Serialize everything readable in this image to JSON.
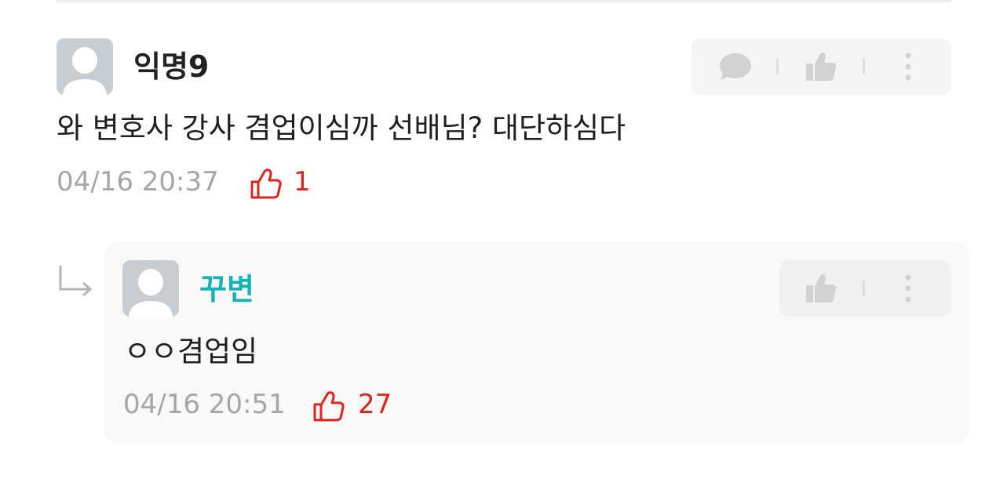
{
  "comment": {
    "author": "익명9",
    "content": "와 변호사 강사 겸업이심까 선배님? 대단하심다",
    "time": "04/16 20:37",
    "likes": "1",
    "actions": [
      "speech-bubble-icon",
      "thumbs-up-icon",
      "more-vertical-icon"
    ]
  },
  "reply": {
    "author": "꾸변",
    "content": "ㅇㅇ겸업임",
    "time": "04/16 20:51",
    "likes": "27",
    "actions": [
      "thumbs-up-icon",
      "more-vertical-icon"
    ]
  },
  "colors": {
    "like_red": "#e0241c",
    "op_author_teal": "#14b3b8",
    "meta_gray": "#a6a6a6"
  }
}
